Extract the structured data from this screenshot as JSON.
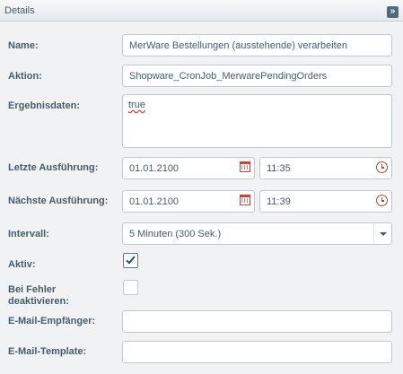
{
  "panel": {
    "title": "Details",
    "collapse_icon": "double-chevron-right-icon",
    "collapse_glyph": "»"
  },
  "form": {
    "name": {
      "label": "Name:",
      "value": "MerWare Bestellungen (ausstehende) verarbeiten"
    },
    "action": {
      "label": "Aktion:",
      "value": "Shopware_CronJob_MerwarePendingOrders"
    },
    "result": {
      "label": "Ergebnisdaten:",
      "value": "true"
    },
    "last_run": {
      "label": "Letzte Ausführung:",
      "date": "01.01.2100",
      "time": "11:35"
    },
    "next_run": {
      "label": "Nächste Ausführung:",
      "date": "01.01.2100",
      "time": "11:39"
    },
    "interval": {
      "label": "Intervall:",
      "value": "5 Minuten (300 Sek.)"
    },
    "active": {
      "label": "Aktiv:",
      "checked": true
    },
    "disable_on_error": {
      "label": "Bei Fehler deaktivieren:",
      "checked": false
    },
    "email_recipient": {
      "label": "E-Mail-Empfänger:",
      "value": ""
    },
    "email_template": {
      "label": "E-Mail-Template:",
      "value": ""
    }
  },
  "colors": {
    "accent": "#c2453d",
    "label": "#475c6a",
    "background": "#f0f2f4"
  }
}
